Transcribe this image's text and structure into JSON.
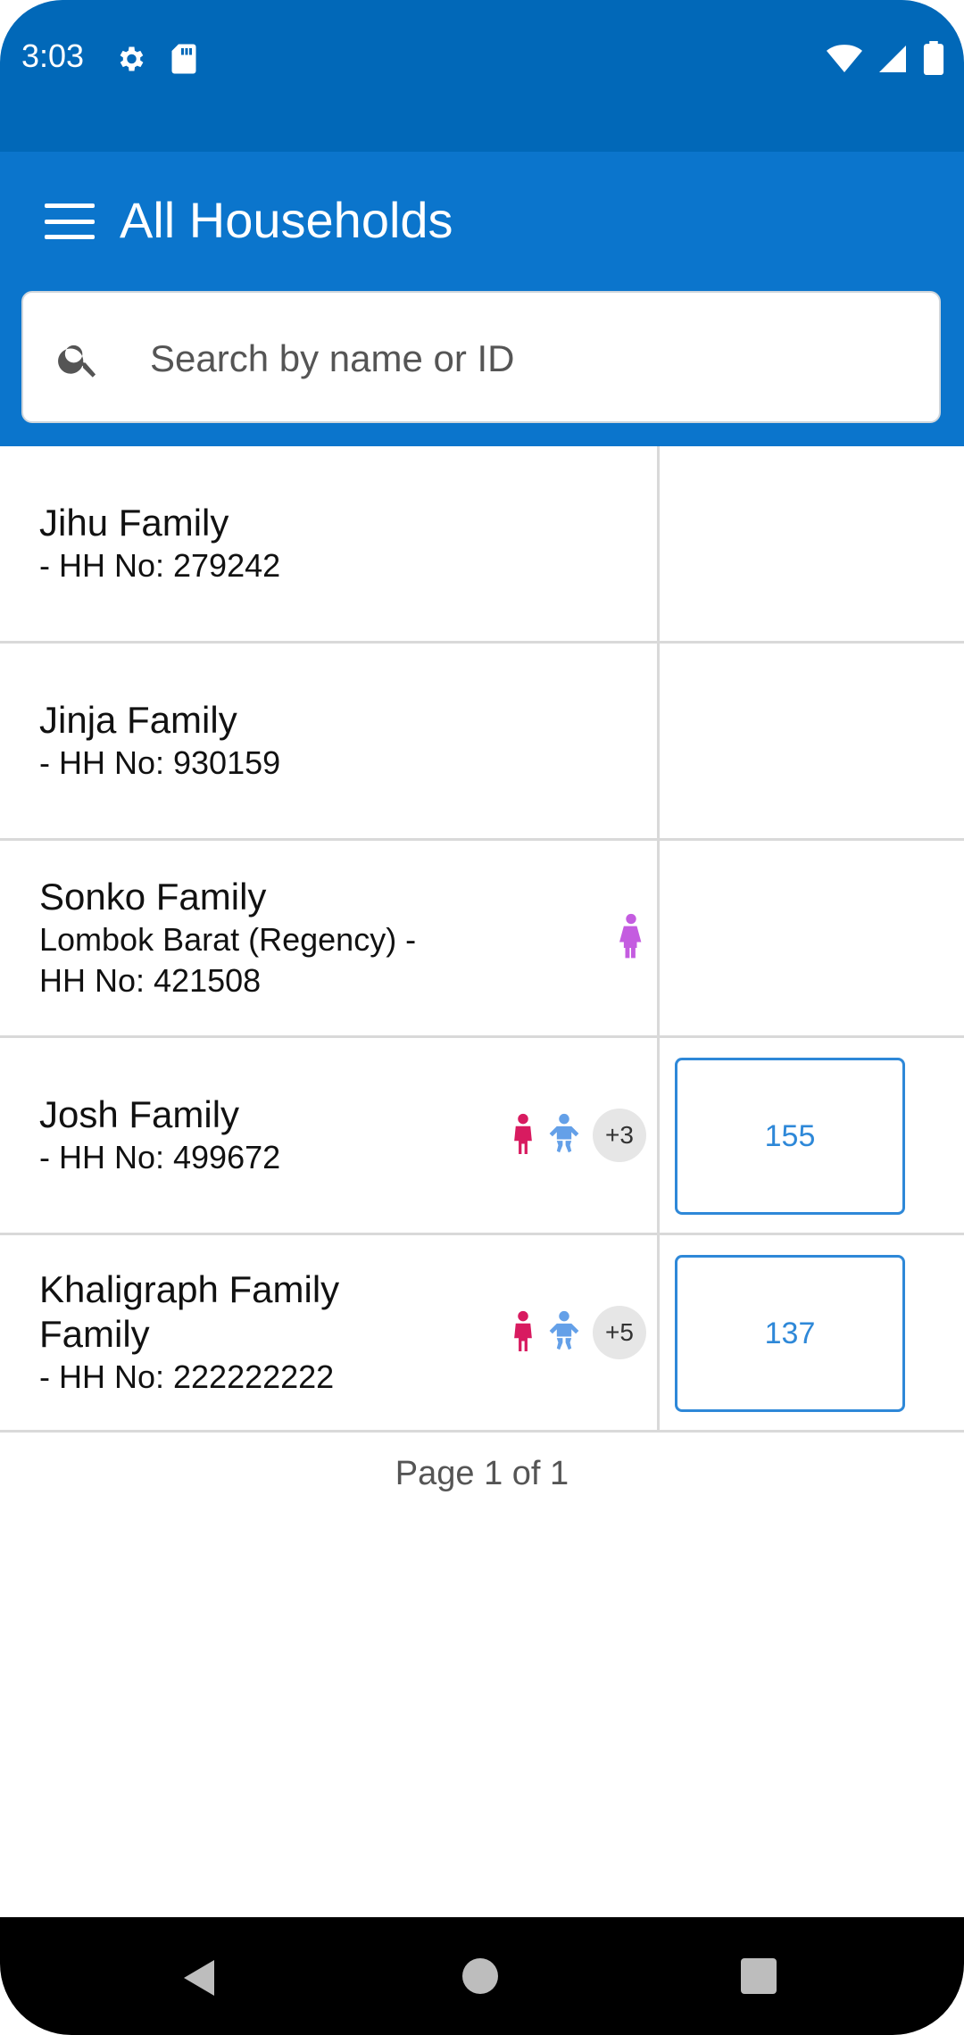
{
  "status_bar": {
    "time": "3:03"
  },
  "app_bar": {
    "title": "All Households"
  },
  "search": {
    "placeholder": "Search by name or ID"
  },
  "households": [
    {
      "name": "Jihu Family",
      "sub1": "- HH No: 279242"
    },
    {
      "name": "Jinja Family",
      "sub1": "- HH No: 930159"
    },
    {
      "name": "Sonko Family",
      "sub1": "Lombok Barat (Regency) -",
      "sub2": "HH No: 421508"
    },
    {
      "name": "Josh Family",
      "sub1": "- HH No: 499672",
      "more": "+3",
      "due": "155"
    },
    {
      "name": "Khaligraph Family",
      "name2": "Family",
      "sub1": "- HH No: 222222222",
      "more": "+5",
      "due": "137"
    }
  ],
  "pagination": {
    "label": "Page 1 of 1"
  },
  "colors": {
    "status": "#0168b8",
    "app_bar": "#0b75cc",
    "accent": "#2e88d8",
    "girl_icon": "#d81b60",
    "child_icon": "#64a0e8",
    "woman_icon": "#c45ce0"
  }
}
